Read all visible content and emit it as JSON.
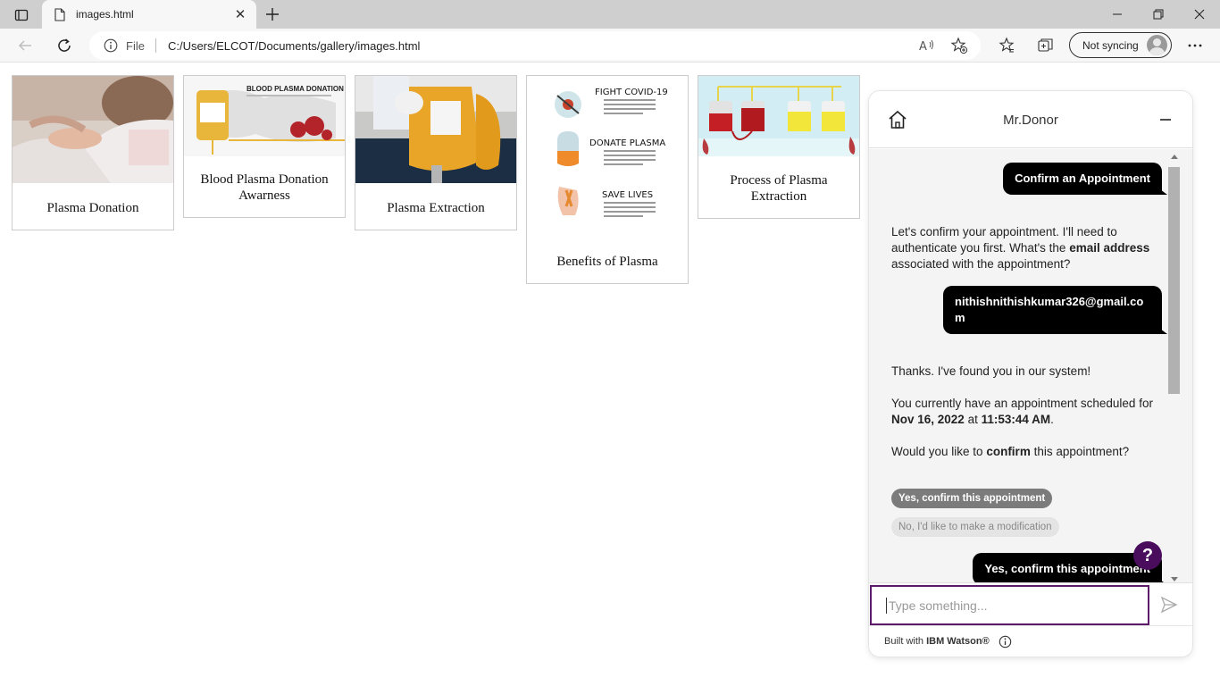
{
  "browser": {
    "tab_title": "images.html",
    "address_label": "File",
    "url": "C:/Users/ELCOT/Documents/gallery/images.html",
    "sync_label": "Not syncing"
  },
  "gallery": {
    "cards": [
      {
        "caption": "Plasma Donation"
      },
      {
        "caption": "Blood Plasma Donation Awarness",
        "poster_title": "BLOOD PLASMA DONATION"
      },
      {
        "caption": "Plasma Extraction"
      },
      {
        "caption": "Benefits of Plasma",
        "infographic": [
          "FIGHT COVID-19",
          "DONATE PLASMA",
          "SAVE LIVES"
        ]
      },
      {
        "caption": "Process of Plasma Extraction"
      }
    ]
  },
  "chat": {
    "title": "Mr.Donor",
    "messages": {
      "user_1": "Confirm an Appointment",
      "bot_1_pre": "Let's confirm your appointment. I'll need to authenticate you first. What's the ",
      "bot_1_bold": "email address",
      "bot_1_post": " associated with the appointment?",
      "user_2": "nithishnithishkumar326@gmail.com",
      "bot_2_line1": "Thanks. I've found you in our system!",
      "bot_2_pre": "You currently have an appointment scheduled for ",
      "bot_2_date": "Nov 16, 2022",
      "bot_2_mid": " at ",
      "bot_2_time": "11:53:44 AM",
      "bot_2_end": ".",
      "bot_3_pre": "Would you like to ",
      "bot_3_bold": "confirm",
      "bot_3_post": " this appointment?",
      "user_3": "Yes, confirm this appointment"
    },
    "options": {
      "yes": "Yes, confirm this appointment",
      "no": "No, I'd like to make a modification"
    },
    "help_label": "?",
    "input_placeholder": "Type something...",
    "footer_pre": "Built with ",
    "footer_bold": "IBM Watson®"
  },
  "colors": {
    "accent_purple": "#4a0c5c",
    "input_border": "#5c1a6a",
    "user_bubble": "#000000"
  }
}
